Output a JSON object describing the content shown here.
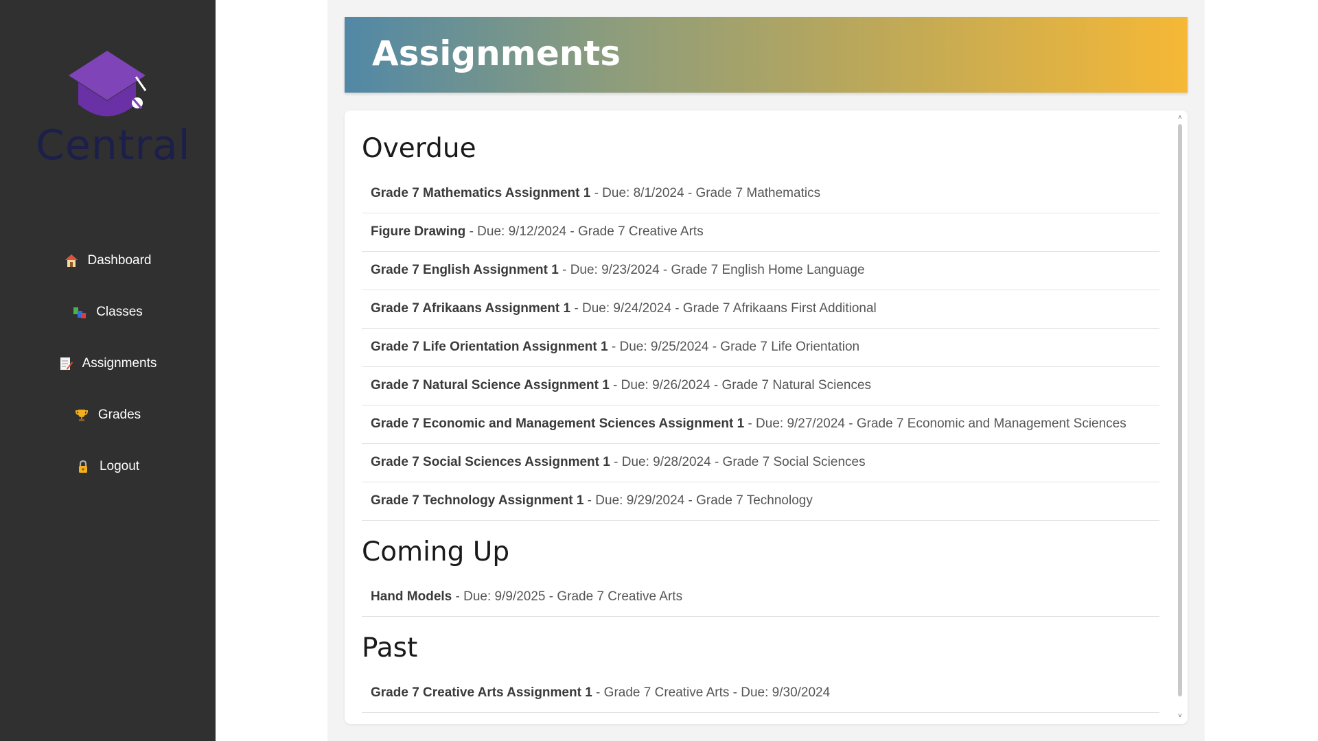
{
  "sidebar": {
    "logo_text": "Central",
    "items": [
      {
        "label": "Dashboard",
        "icon": "house-icon"
      },
      {
        "label": "Classes",
        "icon": "books-icon"
      },
      {
        "label": "Assignments",
        "icon": "memo-icon"
      },
      {
        "label": "Grades",
        "icon": "trophy-icon"
      },
      {
        "label": "Logout",
        "icon": "lock-icon"
      }
    ]
  },
  "header": {
    "title": "Assignments"
  },
  "sections": {
    "overdue": {
      "title": "Overdue",
      "items": [
        {
          "name": "Grade 7 Mathematics Assignment 1",
          "details": " - Due: 8/1/2024 - Grade 7 Mathematics"
        },
        {
          "name": "Figure Drawing",
          "details": " - Due: 9/12/2024 - Grade 7 Creative Arts"
        },
        {
          "name": "Grade 7 English Assignment 1",
          "details": " - Due: 9/23/2024 - Grade 7 English Home Language"
        },
        {
          "name": "Grade 7 Afrikaans Assignment 1",
          "details": " - Due: 9/24/2024 - Grade 7 Afrikaans First Additional"
        },
        {
          "name": "Grade 7 Life Orientation Assignment 1",
          "details": " - Due: 9/25/2024 - Grade 7 Life Orientation"
        },
        {
          "name": "Grade 7 Natural Science Assignment 1",
          "details": " - Due: 9/26/2024 - Grade 7 Natural Sciences"
        },
        {
          "name": "Grade 7 Economic and Management Sciences Assignment 1",
          "details": " - Due: 9/27/2024 - Grade 7 Economic and Management Sciences"
        },
        {
          "name": "Grade 7 Social Sciences Assignment 1",
          "details": " - Due: 9/28/2024 - Grade 7 Social Sciences"
        },
        {
          "name": "Grade 7 Technology Assignment 1",
          "details": " - Due: 9/29/2024 - Grade 7 Technology"
        }
      ]
    },
    "coming_up": {
      "title": "Coming Up",
      "items": [
        {
          "name": "Hand Models",
          "details": " - Due: 9/9/2025 - Grade 7 Creative Arts"
        }
      ]
    },
    "past": {
      "title": "Past",
      "items": [
        {
          "name": "Grade 7 Creative Arts Assignment 1",
          "details": " - Grade 7 Creative Arts - Due: 9/30/2024"
        }
      ]
    }
  },
  "colors": {
    "sidebar_bg": "#303030",
    "logo_purple": "#7e44b8",
    "logo_text": "#1b1f4a",
    "banner_start": "#5188a6",
    "banner_end": "#f6b836"
  }
}
